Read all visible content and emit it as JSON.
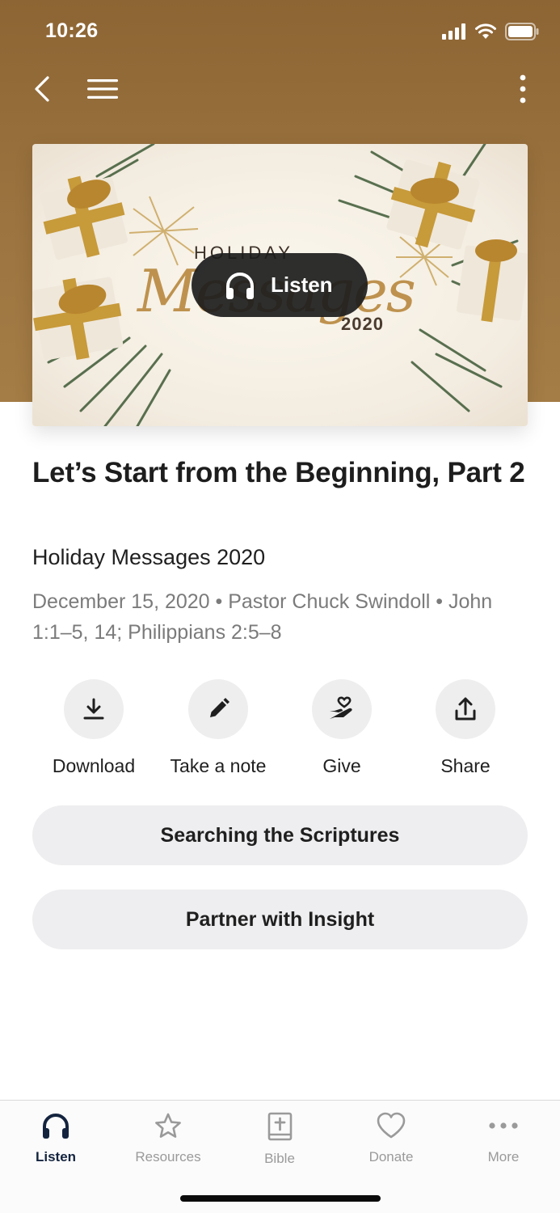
{
  "status_bar": {
    "time": "10:26"
  },
  "nav": {
    "icons": [
      "back-chevron-icon",
      "hamburger-menu-icon",
      "more-vertical-icon"
    ]
  },
  "artwork": {
    "title_small": "HOLIDAY",
    "title_script": "Messages",
    "year": "2020",
    "listen_label": "Listen"
  },
  "episode": {
    "title": "Let’s Start from the Beginning, Part 2",
    "series": "Holiday Messages 2020",
    "meta": "December 15, 2020 • Pastor Chuck Swindoll • John 1:1–5, 14; Philippians 2:5–8"
  },
  "actions": [
    {
      "label": "Download",
      "icon": "download-icon"
    },
    {
      "label": "Take a note",
      "icon": "pencil-icon"
    },
    {
      "label": "Give",
      "icon": "give-heart-hand-icon"
    },
    {
      "label": "Share",
      "icon": "share-icon"
    }
  ],
  "buttons": {
    "scriptures": "Searching the Scriptures",
    "partner": "Partner with Insight"
  },
  "tabbar": {
    "active": "Listen",
    "active_color": "#14243f",
    "inactive_color": "#9a9a9a",
    "items": [
      {
        "label": "Listen",
        "icon": "headphones-icon"
      },
      {
        "label": "Resources",
        "icon": "star-icon"
      },
      {
        "label": "Bible",
        "icon": "bible-icon"
      },
      {
        "label": "Donate",
        "icon": "heart-icon"
      },
      {
        "label": "More",
        "icon": "ellipsis-icon"
      }
    ]
  },
  "colors": {
    "hero": "#9c7440",
    "pill": "#1c1c1c",
    "button_bg": "#eeeef0"
  }
}
